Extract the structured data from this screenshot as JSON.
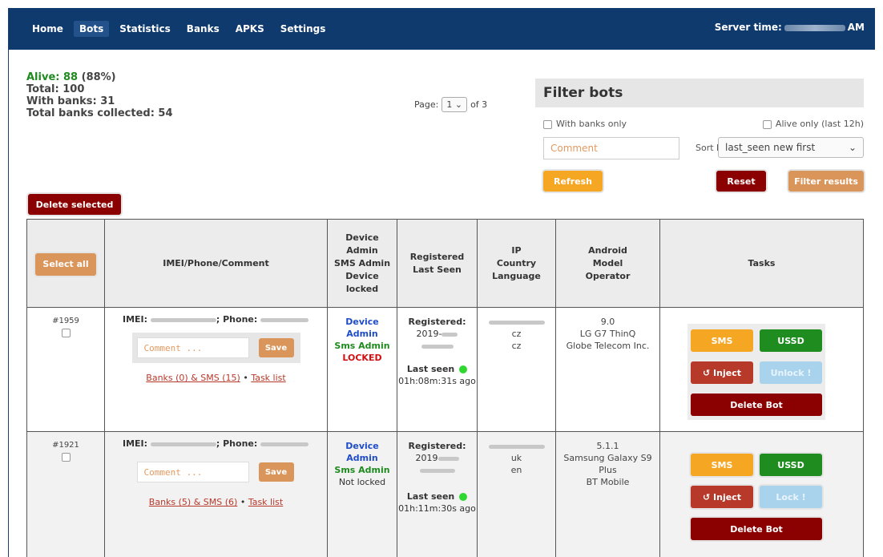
{
  "nav": {
    "items": [
      "Home",
      "Bots",
      "Statistics",
      "Banks",
      "APKS",
      "Settings"
    ],
    "active": "Bots",
    "server_time_label": "Server time:",
    "server_time_suffix": "AM"
  },
  "stats": {
    "alive_label": "Alive: 88",
    "alive_pct": "(88%)",
    "total": "Total: 100",
    "with_banks": "With banks: 31",
    "total_banks": "Total banks collected: 54"
  },
  "pager": {
    "label": "Page:",
    "current": "1",
    "of": "of 3"
  },
  "filter": {
    "title": "Filter bots",
    "with_banks_only": "With banks only",
    "alive_only": "Alive only (last 12h)",
    "comment_placeholder": "Comment",
    "sort_label": "Sort by",
    "sort_value": "last_seen new first",
    "refresh": "Refresh",
    "reset": "Reset",
    "filter_results": "Filter results"
  },
  "delete_selected": "Delete selected",
  "table": {
    "select_all": "Select all",
    "headers": {
      "imei": "IMEI/Phone/Comment",
      "device": [
        "Device",
        "Admin",
        "SMS Admin",
        "Device",
        "locked"
      ],
      "registered": [
        "Registered",
        "Last Seen"
      ],
      "ip": [
        "IP",
        "Country",
        "Language"
      ],
      "android": [
        "Android",
        "Model",
        "Operator"
      ],
      "tasks": "Tasks"
    },
    "rows": [
      {
        "id": "#1959",
        "imei_label": "IMEI:",
        "phone_label": "; Phone:",
        "comment_placeholder": "Comment ...",
        "save": "Save",
        "banks_link": "Banks (0) & SMS (15)",
        "sep": " • ",
        "task_link": "Task list",
        "device_admin_1": "Device",
        "device_admin_2": "Admin",
        "sms_admin": "Sms Admin",
        "lock_status": "LOCKED",
        "registered_label": "Registered:",
        "registered_val": "2019-",
        "last_seen_label": "Last seen",
        "last_seen_ago": "01h:08m:31s ago",
        "country": "cz",
        "language": "cz",
        "android": "9.0",
        "model": "LG G7 ThinQ",
        "operator": "Globe Telecom Inc.",
        "sms": "SMS",
        "ussd": "USSD",
        "inject": "↺ Inject",
        "lock_btn": "Unlock !",
        "delete_bot": "Delete Bot"
      },
      {
        "id": "#1921",
        "imei_label": "IMEI:",
        "phone_label": "; Phone:",
        "comment_placeholder": "Comment ...",
        "save": "Save",
        "banks_link": "Banks (5) & SMS (6)",
        "sep": " • ",
        "task_link": "Task list",
        "device_admin_1": "Device",
        "device_admin_2": "Admin",
        "sms_admin": "Sms Admin",
        "lock_status": "Not locked",
        "registered_label": "Registered:",
        "registered_val": "2019",
        "last_seen_label": "Last seen",
        "last_seen_ago": "01h:11m:30s ago",
        "country": "uk",
        "language": "en",
        "android": "5.1.1",
        "model": "Samsung Galaxy S9 Plus",
        "operator": "BT Mobile",
        "sms": "SMS",
        "ussd": "USSD",
        "inject": "↺ Inject",
        "lock_btn": "Lock !",
        "delete_bot": "Delete Bot"
      }
    ]
  }
}
